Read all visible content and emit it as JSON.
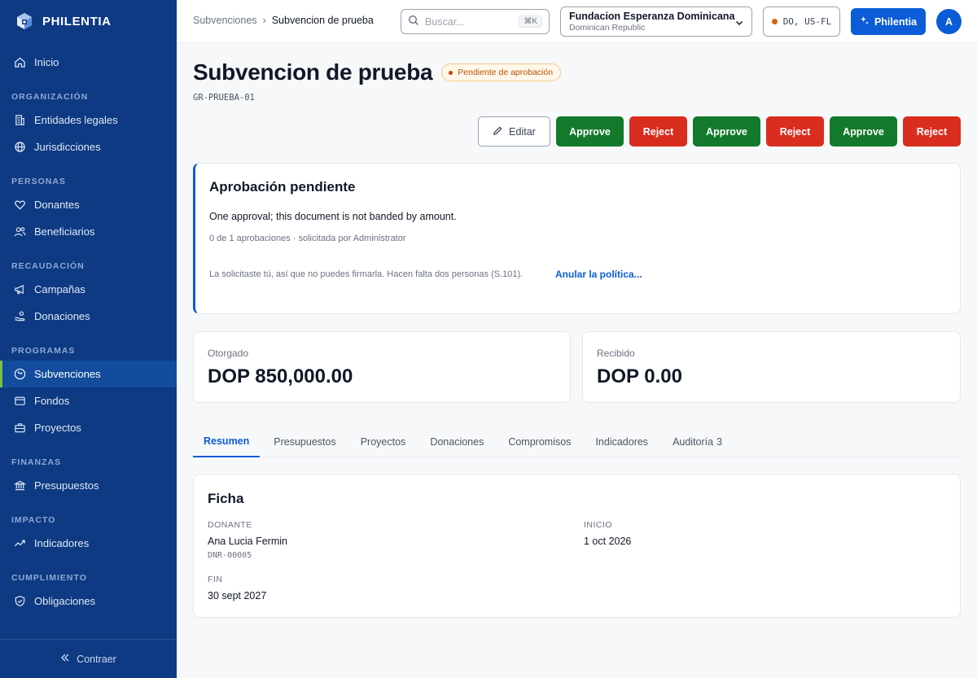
{
  "brand": {
    "name": "PHILENTIA"
  },
  "sidebar": {
    "home": "Inicio",
    "sections": {
      "org": "ORGANIZACIÓN",
      "personas": "PERSONAS",
      "recaudacion": "RECAUDACIÓN",
      "programas": "PROGRAMAS",
      "finanzas": "FINANZAS",
      "impacto": "IMPACTO",
      "cumplimiento": "CUMPLIMIENTO"
    },
    "items": {
      "entidades": "Entidades legales",
      "jurisdicciones": "Jurisdicciones",
      "donantes": "Donantes",
      "beneficiarios": "Beneficiarios",
      "campanas": "Campañas",
      "donaciones": "Donaciones",
      "subvenciones": "Subvenciones",
      "fondos": "Fondos",
      "proyectos": "Proyectos",
      "presupuestos": "Presupuestos",
      "indicadores": "Indicadores",
      "obligaciones": "Obligaciones"
    },
    "active_item": "Subvenciones",
    "collapse_label": "Contraer"
  },
  "topbar": {
    "breadcrumb": {
      "parent": "Subvenciones",
      "separator": "›",
      "current": "Subvencion de prueba"
    },
    "search": {
      "placeholder": "Buscar...",
      "shortcut": "⌘K"
    },
    "org": {
      "name": "Fundacion Esperanza Dominicana",
      "country": "Dominican Republic"
    },
    "jurisdictions": "DO, US-FL",
    "ai_button": "Philentia",
    "avatar_initial": "A"
  },
  "page": {
    "title": "Subvencion de prueba",
    "status": "Pendiente de aprobación",
    "code": "GR-PRUEBA-01"
  },
  "actions": {
    "edit": "Editar",
    "approve": "Approve",
    "reject": "Reject"
  },
  "approval": {
    "title": "Aprobación pendiente",
    "description": "One approval; this document is not banded by amount.",
    "meta": "0 de 1 aprobaciones · solicitada por Administrator",
    "note": "La solicitaste tú, así que no puedes firmarla. Hacen falta dos personas (S.101).",
    "override_link": "Anular la política..."
  },
  "stats": {
    "granted_label": "Otorgado",
    "granted_value": "DOP 850,000.00",
    "received_label": "Recibido",
    "received_value": "DOP 0.00"
  },
  "tabs": {
    "resumen": "Resumen",
    "presupuestos": "Presupuestos",
    "proyectos": "Proyectos",
    "donaciones": "Donaciones",
    "compromisos": "Compromisos",
    "indicadores": "Indicadores",
    "auditoria": "Auditoría",
    "auditoria_count": "3",
    "active": "Resumen"
  },
  "ficha": {
    "title": "Ficha",
    "donor_label": "DONANTE",
    "donor_name": "Ana Lucia Fermin",
    "donor_id": "DNR-00005",
    "start_label": "INICIO",
    "start_value": "1 oct 2026",
    "end_label": "FIN",
    "end_value": "30 sept 2027"
  },
  "colors": {
    "sidebar_bg": "#0d3a82",
    "accent": "#0b5cd6",
    "approve": "#137a2b",
    "reject": "#d92d20",
    "pending": "#b45309",
    "active_marker": "#7ac143"
  }
}
